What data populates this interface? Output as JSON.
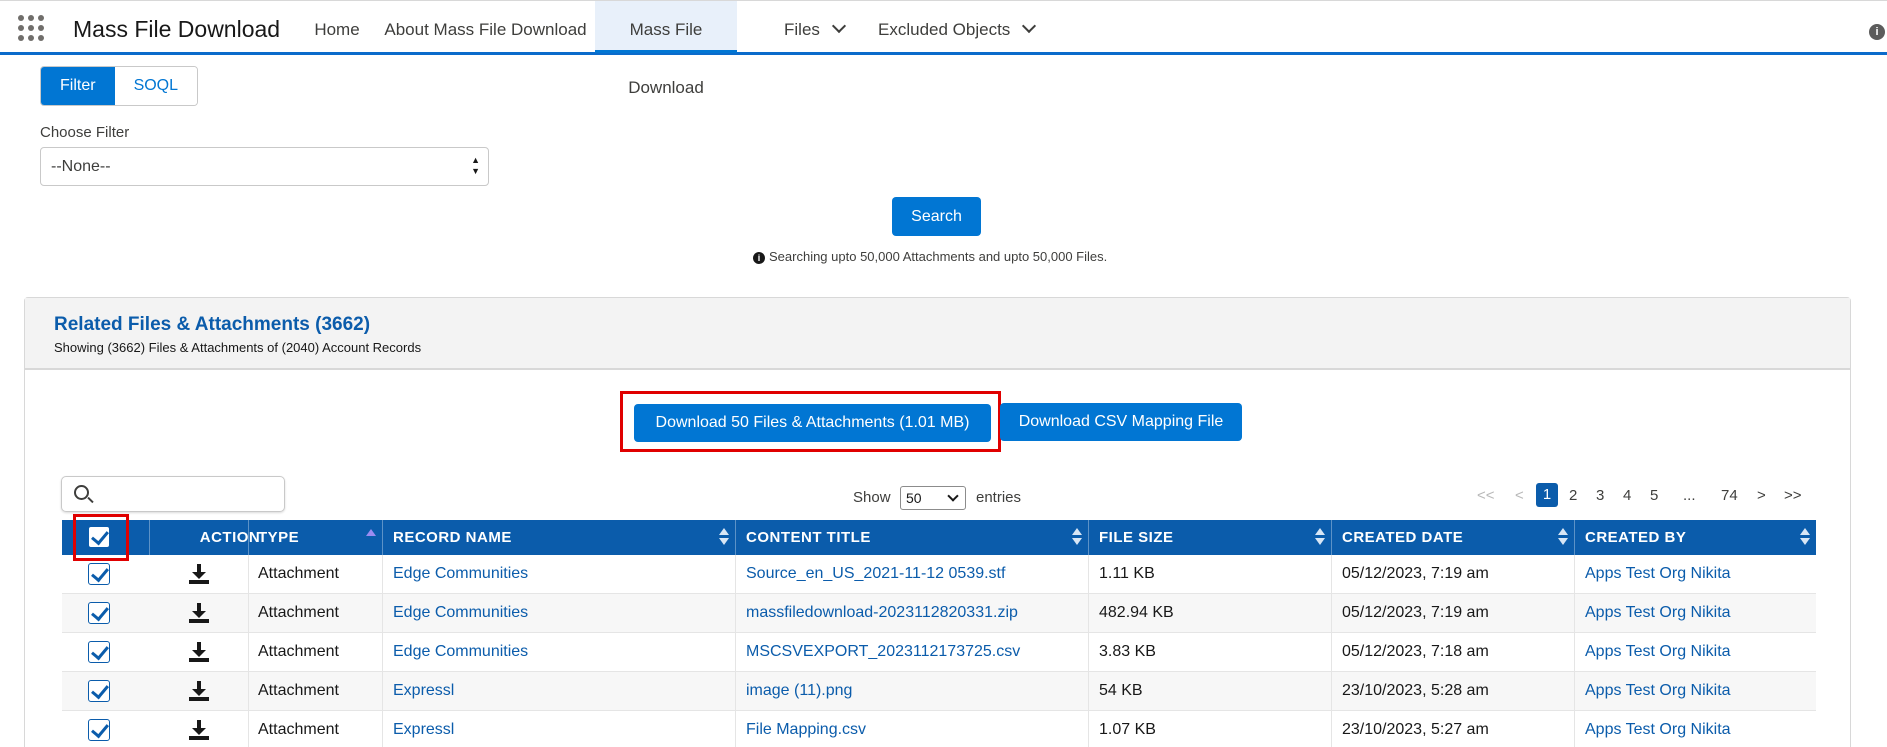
{
  "app": {
    "title": "Mass File Download"
  },
  "nav": {
    "items": [
      {
        "label": "Home"
      },
      {
        "label": "About Mass File Download"
      },
      {
        "label": "Mass File Download"
      },
      {
        "label": "Files"
      },
      {
        "label": "Excluded Objects"
      }
    ],
    "info": "i"
  },
  "tabs": {
    "filter": "Filter",
    "soql": "SOQL"
  },
  "filter": {
    "label": "Choose Filter",
    "value": "--None--",
    "arrows_up": "▲",
    "arrows_down": "▼"
  },
  "search_button": "Search",
  "note": "Searching upto 50,000 Attachments and upto 50,000 Files.",
  "card": {
    "title": "Related Files & Attachments (3662)",
    "subtitle": "Showing (3662) Files & Attachments of (2040) Account Records"
  },
  "actions": {
    "download": "Download 50 Files & Attachments (1.01 MB)",
    "csv": "Download CSV Mapping File"
  },
  "table_controls": {
    "show": "Show",
    "page_size": "50",
    "entries": "entries",
    "pagination": {
      "first": "<<",
      "prev": "<",
      "pages": [
        "1",
        "2",
        "3",
        "4",
        "5"
      ],
      "ellipsis": "...",
      "last_page": "74",
      "next": ">",
      "last": ">>"
    }
  },
  "table": {
    "columns": [
      "ACTION",
      "TYPE",
      "RECORD NAME",
      "CONTENT TITLE",
      "FILE SIZE",
      "CREATED DATE",
      "CREATED BY"
    ],
    "rows": [
      {
        "type": "Attachment",
        "record": "Edge Communities",
        "title": "Source_en_US_2021-11-12 0539.stf",
        "size": "1.11 KB",
        "date": "05/12/2023, 7:19 am",
        "by": "Apps Test Org Nikita"
      },
      {
        "type": "Attachment",
        "record": "Edge Communities",
        "title": "massfiledownload-2023112820331.zip",
        "size": "482.94 KB",
        "date": "05/12/2023, 7:19 am",
        "by": "Apps Test Org Nikita"
      },
      {
        "type": "Attachment",
        "record": "Edge Communities",
        "title": "MSCSVEXPORT_2023112173725.csv",
        "size": "3.83 KB",
        "date": "05/12/2023, 7:18 am",
        "by": "Apps Test Org Nikita"
      },
      {
        "type": "Attachment",
        "record": "Expressl",
        "title": "image (11).png",
        "size": "54 KB",
        "date": "23/10/2023, 5:28 am",
        "by": "Apps Test Org Nikita"
      },
      {
        "type": "Attachment",
        "record": "Expressl",
        "title": "File Mapping.csv",
        "size": "1.07 KB",
        "date": "23/10/2023, 5:27 am",
        "by": "Apps Test Org Nikita"
      }
    ]
  },
  "colors": {
    "brand": "#0176d3",
    "header": "#0b5cab",
    "highlight": "#e00000"
  }
}
